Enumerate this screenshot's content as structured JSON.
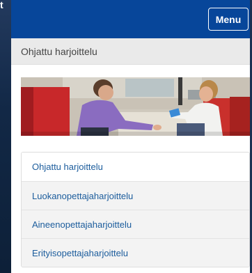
{
  "corner_text": "t",
  "header": {
    "menu_label": "Menu"
  },
  "section": {
    "title": "Ohjattu harjoittelu"
  },
  "hero": {
    "alt": ""
  },
  "nav": {
    "items": [
      {
        "label": "Ohjattu harjoittelu"
      },
      {
        "label": "Luokanopettajaharjoittelu"
      },
      {
        "label": "Aineenopettajaharjoittelu"
      },
      {
        "label": "Erityisopettajaharjoittelu"
      }
    ]
  },
  "colors": {
    "topbar": "#07469a",
    "link": "#1b5c9c",
    "background": "#0f2340"
  }
}
